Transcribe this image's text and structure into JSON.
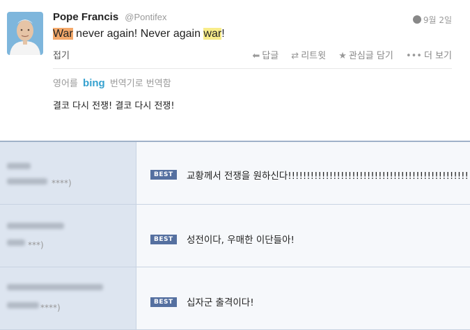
{
  "tweet": {
    "name": "Pope Francis",
    "handle": "@Pontifex",
    "time": "9월 2일",
    "text_war1": "War",
    "text_mid": " never again! Never again ",
    "text_war2": "war",
    "text_end": "!",
    "collapse_label": "접기",
    "actions": {
      "reply": "답글",
      "retweet": "리트윗",
      "favorite": "관심글 담기",
      "more": "더 보기"
    },
    "translate_prefix": "영어를",
    "translate_brand": "bing",
    "translate_suffix": "번역기로 번역함",
    "translated_text": "결코 다시 전쟁! 결코 다시 전쟁!"
  },
  "comments": [
    {
      "badge": "BEST",
      "masked": "****)",
      "text": "교황께서 전쟁을 원하신다!!!!!!!!!!!!!!!!!!!!!!!!!!!!!!!!!!!!!!!!!!!!!!!!!!!!"
    },
    {
      "badge": "BEST",
      "masked": "***)",
      "text": "성전이다, 우매한 이단들아!"
    },
    {
      "badge": "BEST",
      "masked": "****)",
      "text": "십자군 출격이다!"
    }
  ],
  "colors": {
    "highlight_strong": "#f3a86a",
    "highlight_soft": "#f8ec8a",
    "best_badge": "#5570a0",
    "bing": "#35a1cf"
  },
  "icons": {
    "reply": "reply-arrow-icon",
    "retweet": "retweet-icon",
    "favorite": "star-icon",
    "more": "ellipsis-icon",
    "time": "globe-icon"
  }
}
